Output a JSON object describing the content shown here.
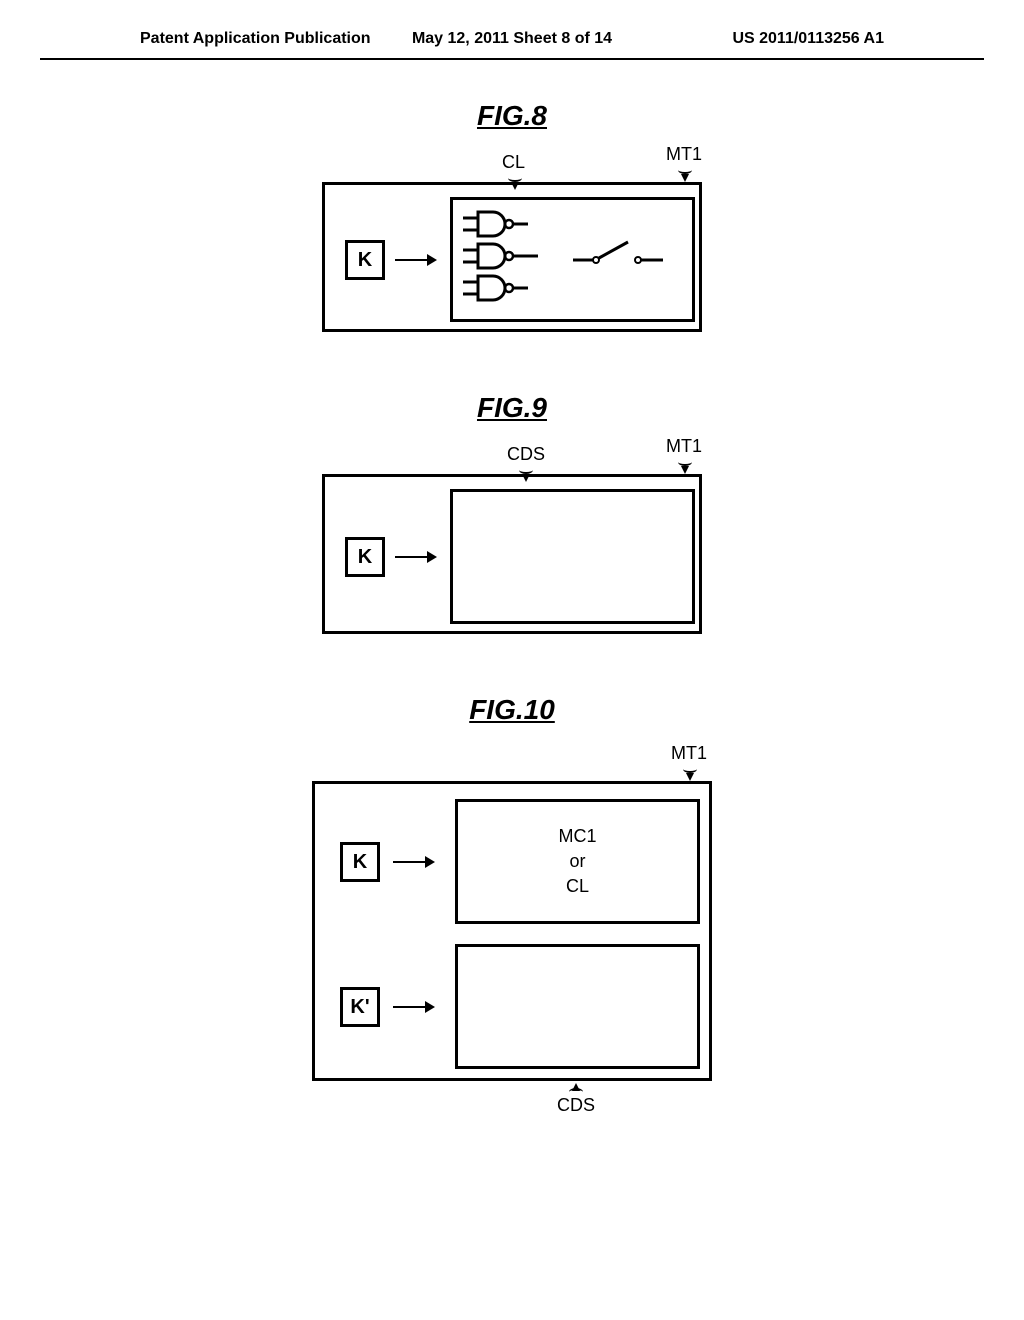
{
  "header": {
    "left": "Patent Application Publication",
    "center": "May 12, 2011  Sheet 8 of 14",
    "right": "US 2011/0113256 A1"
  },
  "figures": {
    "fig8": {
      "title": "FIG.8",
      "label_cl": "CL",
      "label_mt1": "MT1",
      "k_label": "K"
    },
    "fig9": {
      "title": "FIG.9",
      "label_cds": "CDS",
      "label_mt1": "MT1",
      "k_label": "K"
    },
    "fig10": {
      "title": "FIG.10",
      "label_mt1": "MT1",
      "label_cds": "CDS",
      "k_label": "K",
      "kprime_label": "K'",
      "inner_mc1": "MC1",
      "inner_or": "or",
      "inner_cl": "CL"
    }
  }
}
